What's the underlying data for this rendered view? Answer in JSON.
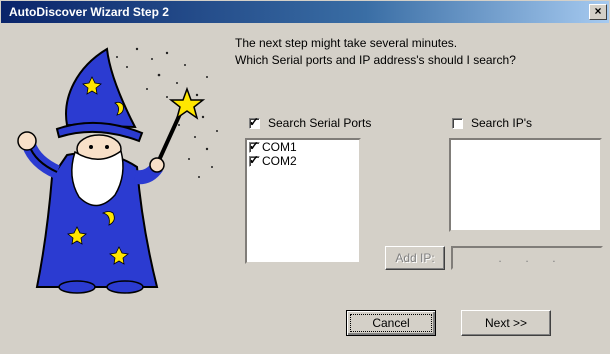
{
  "window": {
    "title": "AutoDiscover Wizard Step 2",
    "close_label": "×"
  },
  "intro": {
    "line1": "The next step might take several minutes.",
    "line2": "Which Serial ports and IP address's should I search?"
  },
  "serial": {
    "label": "Search Serial Ports",
    "checked": true,
    "ports": [
      {
        "label": "COM1",
        "checked": true
      },
      {
        "label": "COM2",
        "checked": true
      }
    ]
  },
  "ip": {
    "label": "Search IP's",
    "checked": false,
    "add_button": "Add IP:",
    "address_dots": [
      ".",
      ".",
      "."
    ]
  },
  "buttons": {
    "cancel": "Cancel",
    "next": "Next >>"
  },
  "colors": {
    "titlebar_start": "#0a246a",
    "titlebar_end": "#a6caf0",
    "face": "#d4d0c8",
    "robe": "#2b3bd1",
    "star": "#ffe600"
  },
  "icons": {
    "wizard": "wizard-illustration"
  }
}
